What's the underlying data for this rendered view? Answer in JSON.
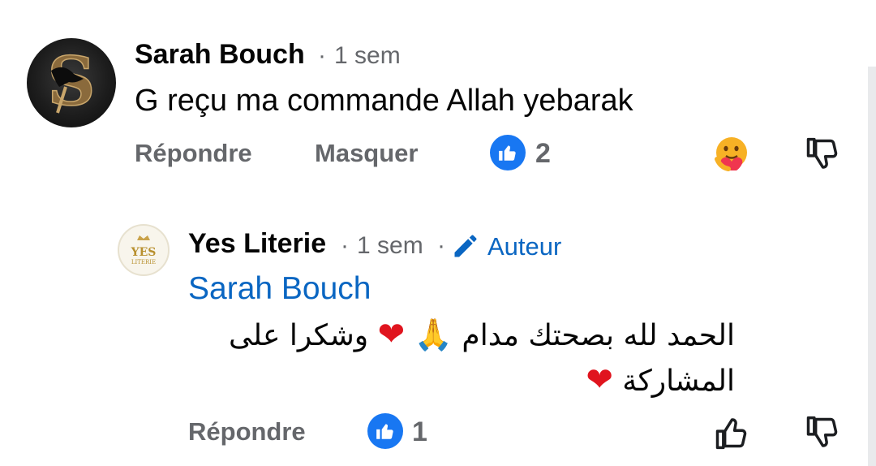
{
  "comment": {
    "author": "Sarah Bouch",
    "separator": "·",
    "time": "1 sem",
    "text": "G reçu ma commande Allah yebarak",
    "actions": {
      "reply": "Répondre",
      "hide": "Masquer"
    },
    "like_count": "2"
  },
  "reply": {
    "author": "Yes Literie",
    "separator": "·",
    "time": "1 sem",
    "separator2": "·",
    "author_badge": "Auteur",
    "mention": "Sarah Bouch",
    "text_part1": "الحمد لله بصحتك مدام",
    "text_part2": "وشكرا على",
    "text_part3": "المشاركة",
    "emoji_heart": "❤",
    "emoji_pray": "🙏",
    "actions": {
      "reply": "Répondre"
    },
    "like_count": "1"
  },
  "logo_text": "YES LITERIE",
  "colors": {
    "accent": "#1877f2",
    "meta": "#65676b",
    "link": "#0a66c2",
    "heart": "#e0141e"
  },
  "icons": [
    "like-badge-icon",
    "care-reaction-icon",
    "thumbs-down-icon",
    "thumbs-up-icon",
    "pencil-icon"
  ]
}
